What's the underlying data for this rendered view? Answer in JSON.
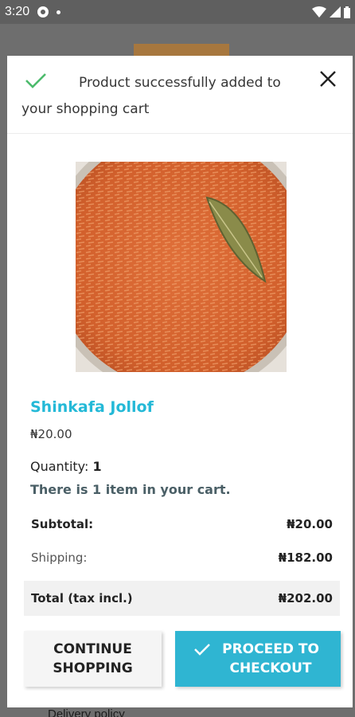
{
  "status_bar": {
    "time": "3:20"
  },
  "background": {
    "footer_text": "Delivery policy"
  },
  "modal": {
    "message": "Product successfully added to your shopping cart",
    "product": {
      "name": "Shinkafa Jollof",
      "price": "₦20.00",
      "quantity_label": "Quantity:",
      "quantity": "1",
      "cart_count_text": "There is 1 item in your cart."
    },
    "summary": {
      "subtotal_label": "Subtotal:",
      "subtotal_value": "₦20.00",
      "shipping_label": "Shipping:",
      "shipping_value": "₦182.00",
      "total_label": "Total (tax incl.)",
      "total_value": "₦202.00"
    },
    "buttons": {
      "continue_label": "CONTINUE SHOPPING",
      "checkout_label": "PROCEED TO CHECKOUT"
    }
  },
  "colors": {
    "accent": "#2fb5d2",
    "success": "#4cbb6c",
    "product_name": "#24b9d7"
  },
  "icons": [
    "gear-icon",
    "dot-icon",
    "wifi-icon",
    "signal-icon",
    "battery-icon",
    "check-icon",
    "close-icon"
  ]
}
